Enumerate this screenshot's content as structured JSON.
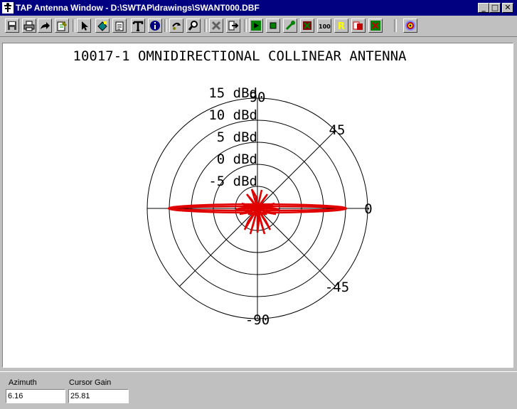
{
  "window": {
    "title": "TAP Antenna Window - D:\\SWTAP\\drawings\\SWANT000.DBF",
    "buttons": [
      {
        "name": "minimize",
        "glyph": "_"
      },
      {
        "name": "maximize",
        "glyph": "□"
      },
      {
        "name": "close",
        "glyph": "✕"
      }
    ]
  },
  "toolbar": {
    "buttons": [
      {
        "name": "save-icon"
      },
      {
        "name": "print-icon"
      },
      {
        "name": "export-icon"
      },
      {
        "name": "edit-icon"
      },
      {
        "name": "pointer-icon"
      },
      {
        "name": "paint-icon"
      },
      {
        "name": "clipboard-icon"
      },
      {
        "name": "text-icon"
      },
      {
        "name": "info-icon"
      },
      {
        "name": "rotate-icon"
      },
      {
        "name": "zoom-icon"
      },
      {
        "name": "delete-icon"
      },
      {
        "name": "import-icon"
      },
      {
        "name": "play-green-icon"
      },
      {
        "name": "stop-green-icon"
      },
      {
        "name": "probe-icon"
      },
      {
        "name": "cut-red-icon"
      },
      {
        "name": "zoom-100-icon",
        "label": "100%"
      },
      {
        "name": "r-yellow-icon",
        "label": "R"
      },
      {
        "name": "copy-red-icon"
      },
      {
        "name": "grid-green-icon"
      },
      {
        "name": "target-icon"
      }
    ]
  },
  "plot": {
    "title": "10017-1 OMNIDIRECTIONAL COLLINEAR ANTENNA",
    "ring_labels": [
      "15 dBd",
      "10 dBd",
      "5 dBd",
      "0 dBd",
      "-5 dBd"
    ],
    "angle_labels": {
      "deg90": "90",
      "deg45": "45",
      "deg0": "0",
      "degm45": "-45",
      "degm90": "-90"
    },
    "pattern_color": "#e00000"
  },
  "status": {
    "azimuth_label": "Azimuth",
    "azimuth_value": "6.16",
    "gain_label": "Cursor Gain",
    "gain_value": "25.81"
  }
}
